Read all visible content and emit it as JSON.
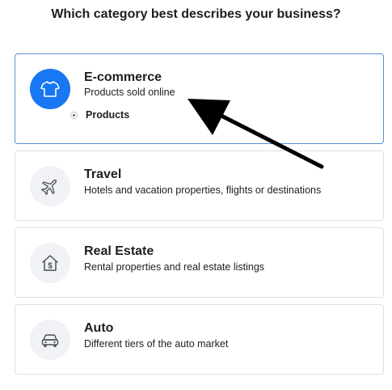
{
  "page": {
    "title": "Which category best describes your business?"
  },
  "categories": [
    {
      "name": "E-commerce",
      "description": "Products sold online",
      "icon": "tshirt-icon",
      "selected": true,
      "sub_option": "Products"
    },
    {
      "name": "Travel",
      "description": "Hotels and vacation properties, flights or destinations",
      "icon": "airplane-icon",
      "selected": false
    },
    {
      "name": "Real Estate",
      "description": "Rental properties and real estate listings",
      "icon": "house-dollar-icon",
      "selected": false
    },
    {
      "name": "Auto",
      "description": "Different tiers of the auto market",
      "icon": "car-icon",
      "selected": false
    }
  ],
  "colors": {
    "accent": "#1877f2",
    "selected_border": "#5b8fd1",
    "card_border": "#dddfe2",
    "icon_bg": "#f0f2f5",
    "arrow": "#000000"
  }
}
